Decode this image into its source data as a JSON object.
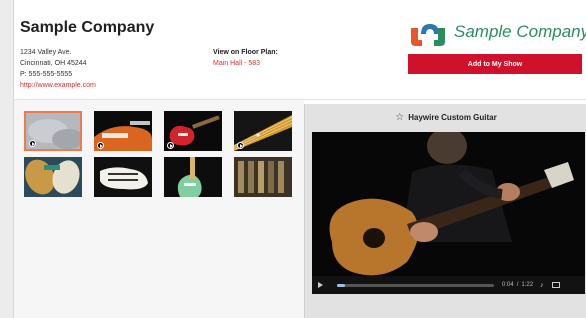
{
  "company": {
    "name": "Sample Company",
    "address_line1": "1234 Valley Ave.",
    "address_line2": "Cincinnati, OH 45244",
    "phone": "P: 555-555-5555",
    "website": "http://www.example.com"
  },
  "floor_plan": {
    "label": "View on Floor Plan:",
    "link_text": "Main Hall - 583"
  },
  "logo": {
    "text": "Sample Company",
    "colors": {
      "orange": "#e8572a",
      "blue": "#2f74b5",
      "green": "#2a8c5f"
    }
  },
  "actions": {
    "add_to_show_label": "Add to My Show"
  },
  "colors": {
    "accent_red": "#d1112b",
    "link_red": "#d9302e",
    "thumb_selected_border": "#f07a4d"
  },
  "thumbnails": [
    {
      "name": "gray-abstract",
      "selected": true,
      "has_video_badge": true
    },
    {
      "name": "orange-guitar-closeup",
      "selected": false,
      "has_video_badge": true
    },
    {
      "name": "red-guitar",
      "selected": false,
      "has_video_badge": true
    },
    {
      "name": "guitar-neck-strings",
      "selected": false,
      "has_video_badge": true
    },
    {
      "name": "guitar-bodies-pattern",
      "selected": false,
      "has_video_badge": false
    },
    {
      "name": "white-guitar-body",
      "selected": false,
      "has_video_badge": false
    },
    {
      "name": "green-guitar",
      "selected": false,
      "has_video_badge": false
    },
    {
      "name": "guitar-wall-display",
      "selected": false,
      "has_video_badge": false
    }
  ],
  "player": {
    "title": "Haywire Custom Guitar",
    "current_time": "0:04",
    "separator": "/",
    "duration": "1:22",
    "progress": 0.05
  }
}
